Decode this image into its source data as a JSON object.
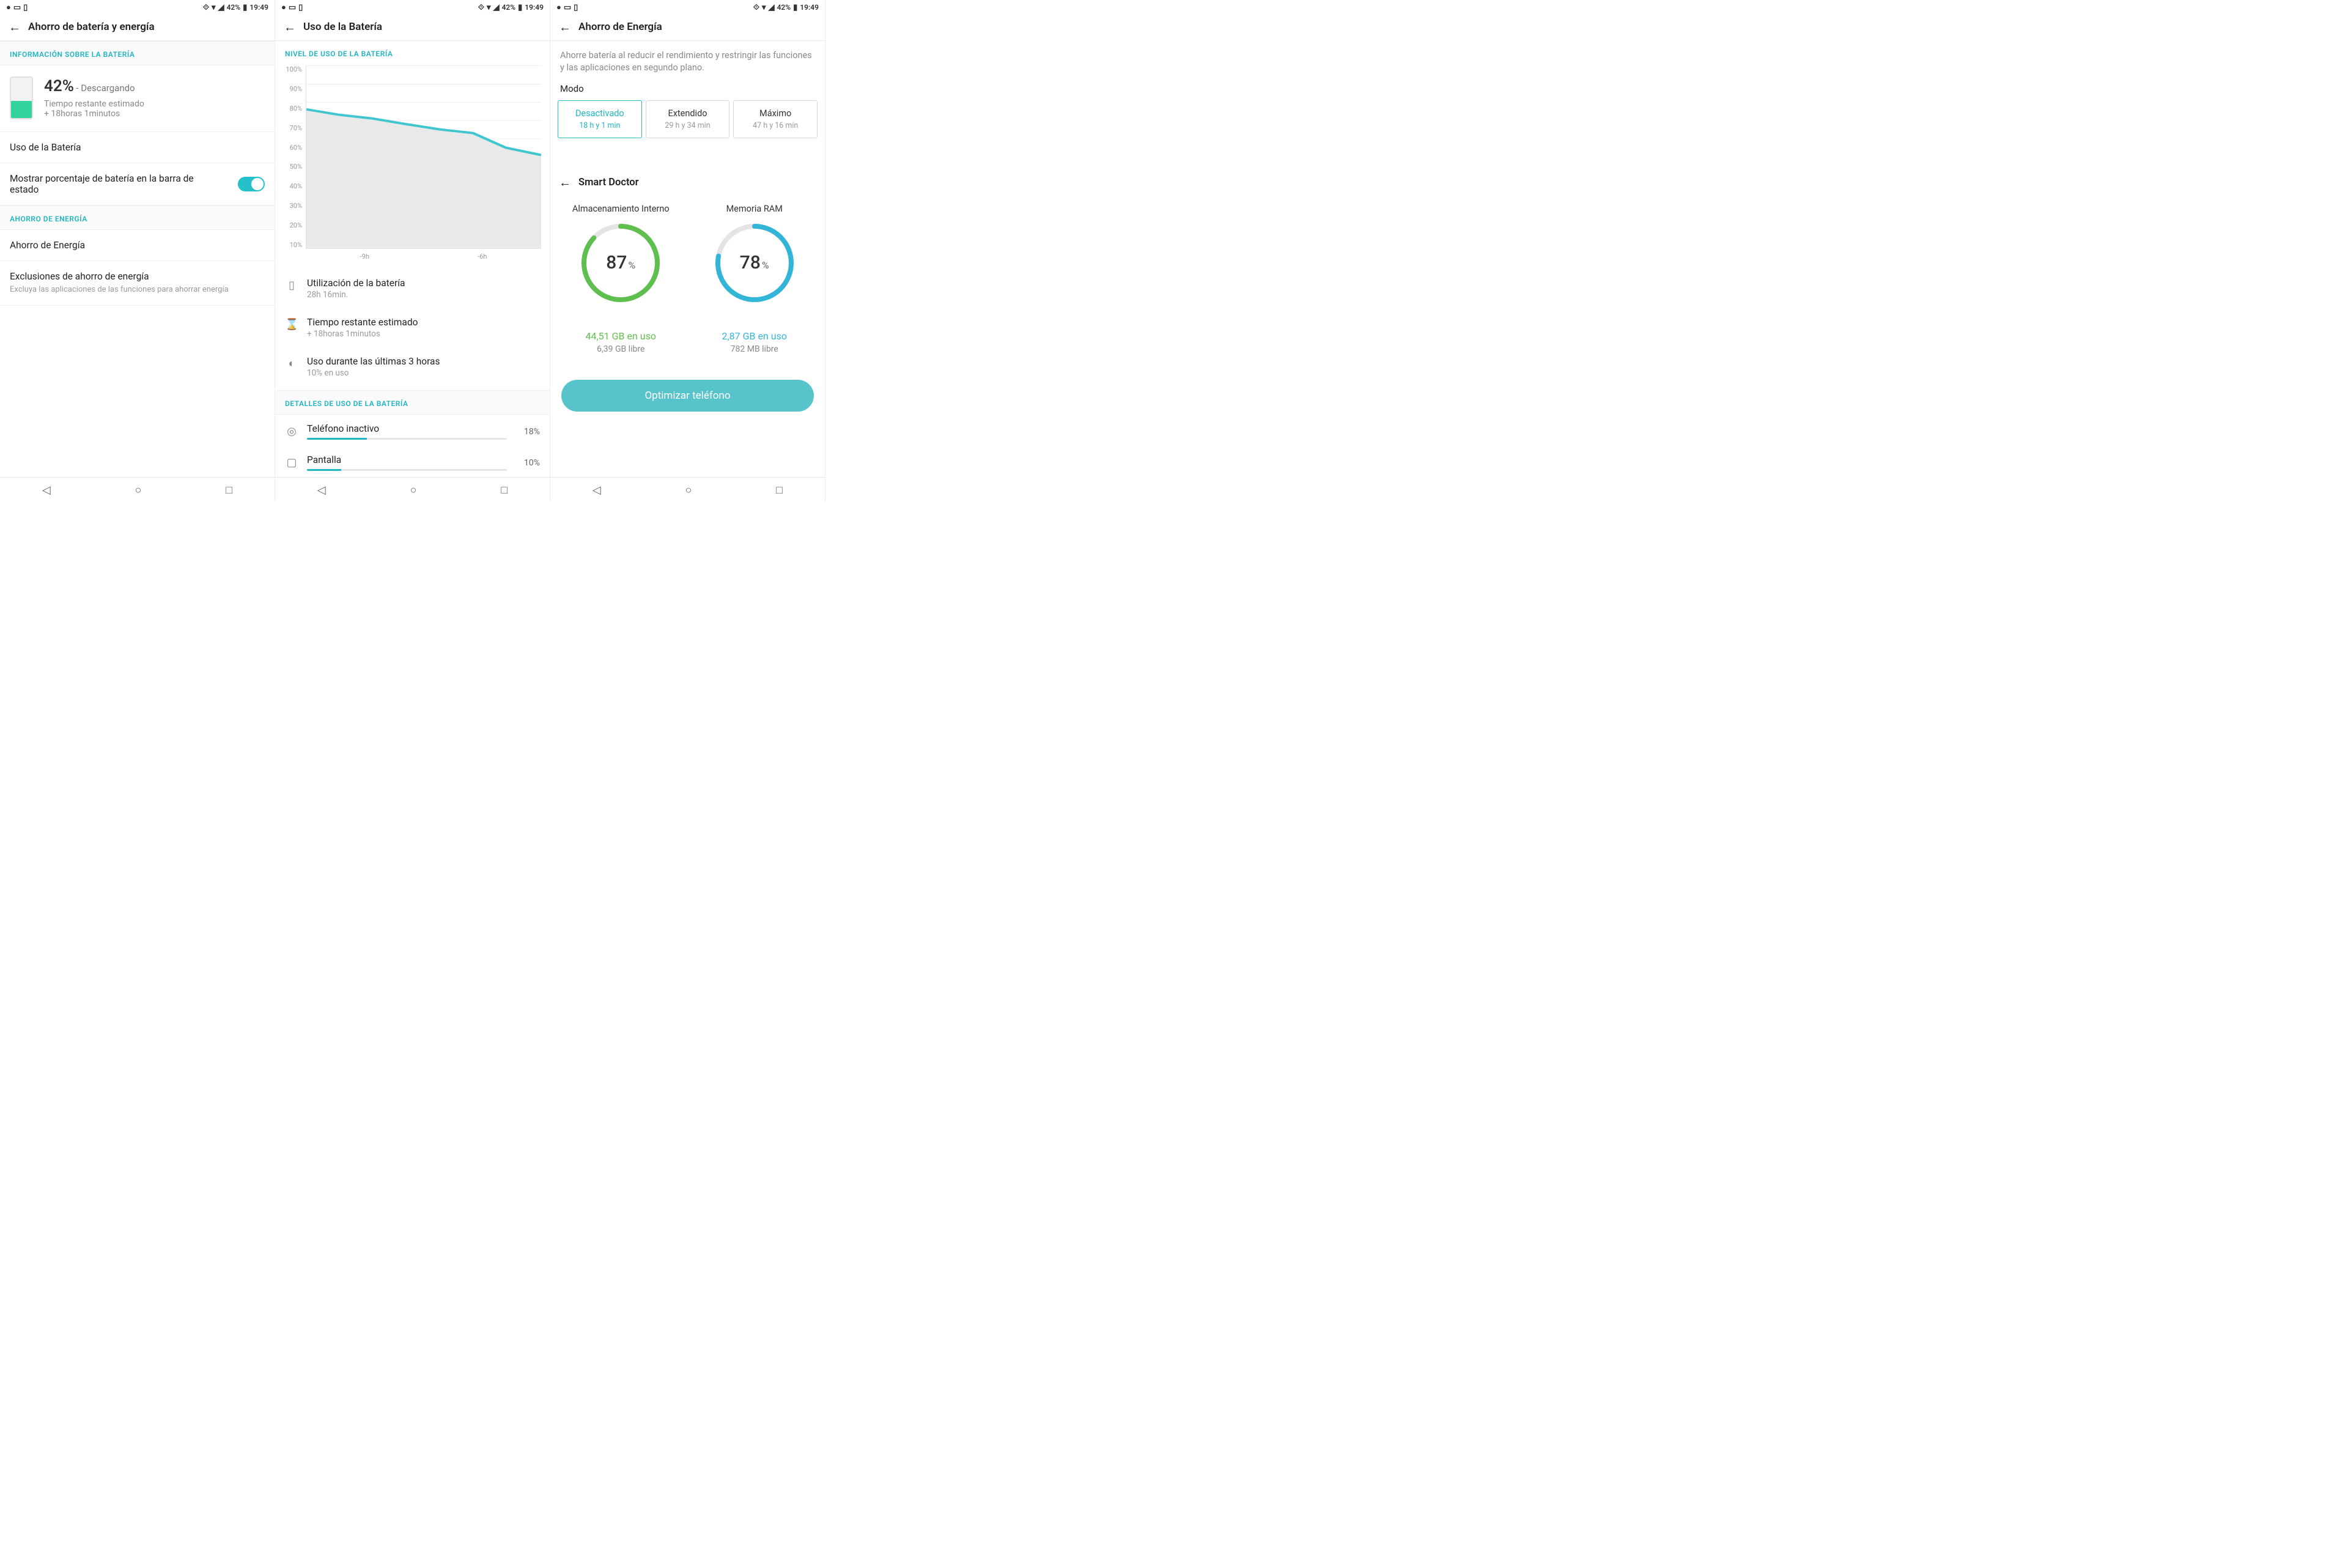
{
  "status": {
    "battery_pct_text": "42%",
    "time": "19:49"
  },
  "screen1": {
    "title": "Ahorro de batería y energía",
    "section_info": "INFORMACIÓN SOBRE LA BATERÍA",
    "pct": "42%",
    "status": "- Descargando",
    "est_label": "Tiempo restante estimado",
    "est_value": "+ 18horas 1minutos",
    "row_usage": "Uso de la Batería",
    "row_pct_toggle": "Mostrar porcentaje de batería en la barra de estado",
    "section_saving": "AHORRO DE ENERGÍA",
    "row_saving": "Ahorro de Energía",
    "row_excl": "Exclusiones de ahorro de energía",
    "row_excl_sub": "Excluya las aplicaciones de las funciones para ahorrar energía"
  },
  "screen2": {
    "title": "Uso de la Batería",
    "section_level": "NIVEL DE USO DE LA BATERÍA",
    "stat1_t": "Utilización de la batería",
    "stat1_s": "28h 16min.",
    "stat2_t": "Tiempo restante estimado",
    "stat2_s": "+ 18horas 1minutos",
    "stat3_t": "Uso durante las últimas 3 horas",
    "stat3_s": "10% en uso",
    "section_detail": "DETALLES DE USO DE LA BATERÍA",
    "detail1_t": "Teléfono inactivo",
    "detail1_p": "18%",
    "detail2_t": "Pantalla",
    "detail2_p": "10%"
  },
  "screen3": {
    "title": "Ahorro de Energía",
    "desc": "Ahorre batería al reducir el rendimiento y restringir las funciones y las aplicaciones en segundo plano.",
    "modo": "Modo",
    "mode1_t": "Desactivado",
    "mode1_s": "18 h y 1 min",
    "mode2_t": "Extendido",
    "mode2_s": "29 h y 34 min",
    "mode3_t": "Máximo",
    "mode3_s": "47 h y 16 min",
    "smart_title": "Smart Doctor",
    "donut1_t": "Almacenamiento Interno",
    "donut1_v": "87",
    "donut2_t": "Memoria RAM",
    "donut2_v": "78",
    "used1": "44,51  GB en uso",
    "free1": "6,39 GB libre",
    "used2": "2,87  GB en uso",
    "free2": "782 MB libre",
    "optimize": "Optimizar teléfono"
  },
  "chart_data": {
    "type": "area",
    "title": "NIVEL DE USO DE LA BATERÍA",
    "xlabel": "",
    "ylabel": "%",
    "ylim": [
      0,
      100
    ],
    "x_ticks": [
      "-9h",
      "-6h"
    ],
    "y_ticks": [
      "100%",
      "90%",
      "80%",
      "70%",
      "60%",
      "50%",
      "40%",
      "30%",
      "20%",
      "10%"
    ],
    "x": [
      -11,
      -10,
      -9,
      -8,
      -7,
      -6,
      -5,
      -4
    ],
    "values": [
      76,
      73,
      71,
      68,
      65,
      63,
      55,
      51
    ]
  }
}
